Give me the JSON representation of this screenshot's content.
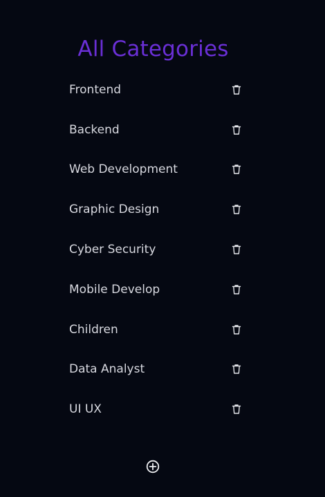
{
  "page": {
    "title": "All Categories"
  },
  "categories": [
    {
      "label": "Frontend",
      "delete_icon": "trash-icon"
    },
    {
      "label": "Backend",
      "delete_icon": "trash-icon"
    },
    {
      "label": "Web Development",
      "delete_icon": "trash-icon"
    },
    {
      "label": "Graphic Design",
      "delete_icon": "trash-icon"
    },
    {
      "label": "Cyber Security",
      "delete_icon": "trash-icon"
    },
    {
      "label": "Mobile Develop",
      "delete_icon": "trash-icon"
    },
    {
      "label": "Children",
      "delete_icon": "trash-icon"
    },
    {
      "label": "Data Analyst",
      "delete_icon": "trash-icon"
    },
    {
      "label": "UI UX",
      "delete_icon": "trash-icon"
    }
  ],
  "actions": {
    "add_icon": "plus-circle-icon"
  },
  "colors": {
    "background": "#050812",
    "title": "#6a2fd6",
    "text": "#d8d9e0"
  }
}
